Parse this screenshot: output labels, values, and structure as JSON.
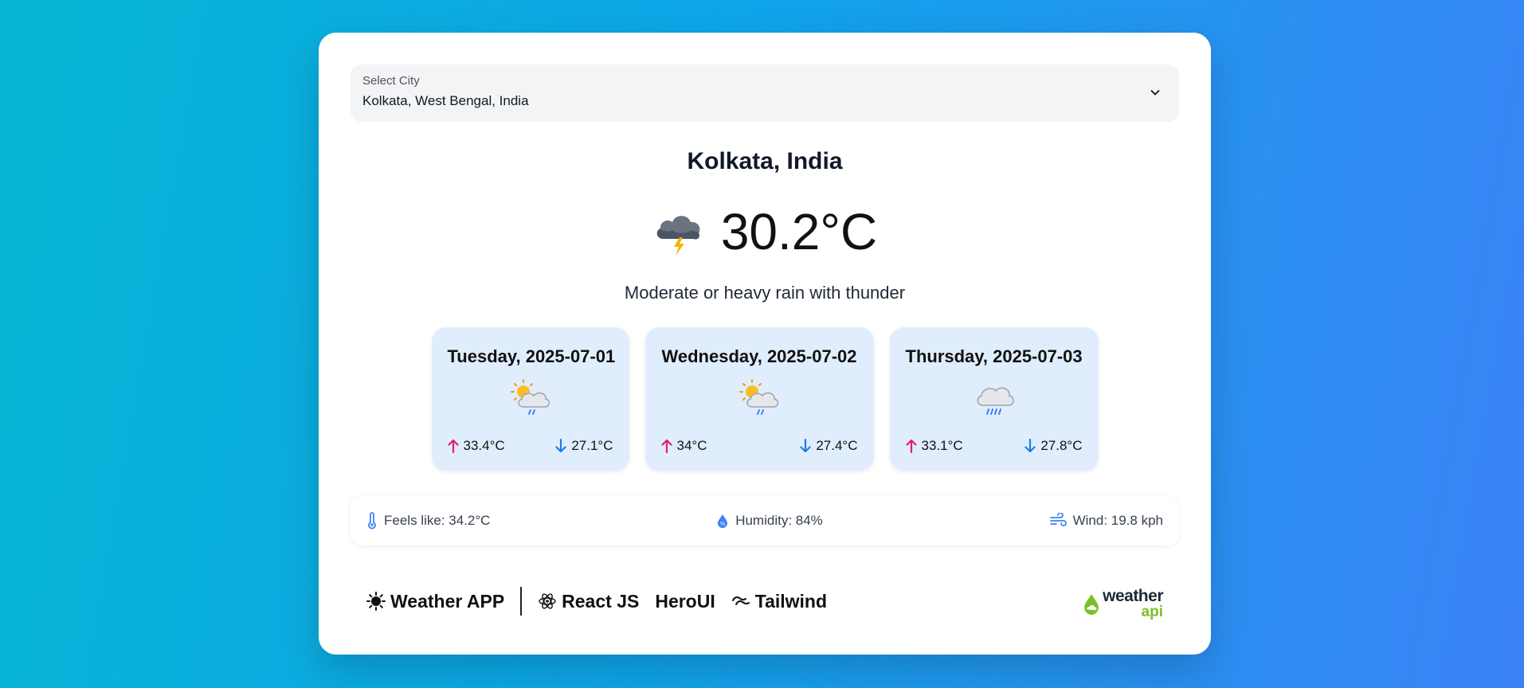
{
  "city_select": {
    "label": "Select City",
    "value": "Kolkata, West Bengal, India"
  },
  "location": {
    "title": "Kolkata, India"
  },
  "current": {
    "temp": "30.2°C",
    "condition": "Moderate or heavy rain with thunder",
    "icon": "thunderstorm-icon"
  },
  "forecast": [
    {
      "date": "Tuesday, 2025-07-01",
      "icon": "sun-cloud-rain-icon",
      "max": "33.4°C",
      "min": "27.1°C"
    },
    {
      "date": "Wednesday, 2025-07-02",
      "icon": "sun-cloud-rain-icon",
      "max": "34°C",
      "min": "27.4°C"
    },
    {
      "date": "Thursday, 2025-07-03",
      "icon": "cloud-rain-icon",
      "max": "33.1°C",
      "min": "27.8°C"
    }
  ],
  "details": {
    "feels_like": "Feels like: 34.2°C",
    "humidity": "Humidity: 84%",
    "wind": "Wind: 19.8 kph"
  },
  "footer": {
    "app_name": "Weather APP",
    "tech": [
      "React JS",
      "HeroUI",
      "Tailwind"
    ],
    "api_logo": {
      "line1": "weather",
      "line2": "api"
    }
  },
  "colors": {
    "max_arrow": "#e11d74",
    "min_arrow": "#1d7ee6",
    "card_bg": "#e0edfc",
    "api_green": "#7cbf2a"
  }
}
